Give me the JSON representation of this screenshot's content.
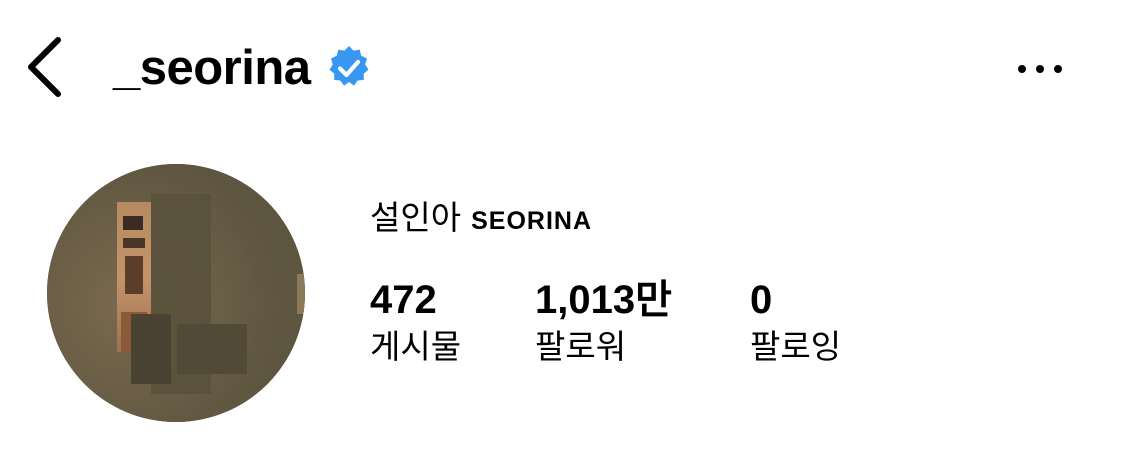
{
  "header": {
    "username": "_seorina",
    "verified_icon": "verified-badge-icon",
    "back_icon": "chevron-left-icon",
    "more_icon": "more-horizontal-icon",
    "verified_color": "#3897f0"
  },
  "profile": {
    "display_name_korean": "설인아",
    "display_name_english": "SEORINA",
    "avatar_icon": "profile-photo"
  },
  "stats": {
    "posts": {
      "count": "472",
      "label": "게시물"
    },
    "followers": {
      "count": "1,013만",
      "label": "팔로워"
    },
    "following": {
      "count": "0",
      "label": "팔로잉"
    }
  }
}
